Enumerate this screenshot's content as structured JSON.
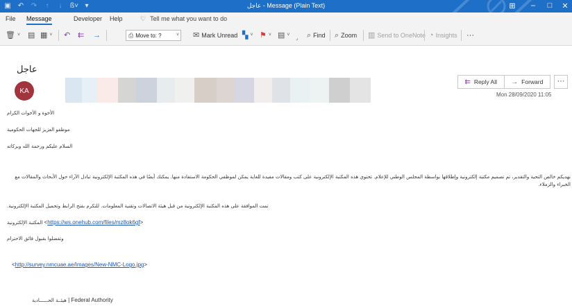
{
  "window": {
    "title": "عاجل  -  Message (Plain Text)",
    "quick_access_icons": [
      "save-icon",
      "undo-icon",
      "redo-icon",
      "up-icon",
      "down-icon",
      "format-icon",
      "customize-icon"
    ]
  },
  "menu": {
    "tabs": [
      "File",
      "Message",
      "Developer",
      "Help"
    ],
    "active_tab": "Message",
    "tell_me": "Tell me what you want to do"
  },
  "ribbon": {
    "move_to_label": "Move to: ?",
    "mark_unread": "Mark Unread",
    "find": "Find",
    "zoom": "Zoom",
    "send_to_onenote": "Send to OneNote",
    "insights": "Insights",
    "more": "···"
  },
  "message": {
    "subject": "عاجل",
    "avatar_initials": "KA",
    "reply_all": "Reply All",
    "forward": "Forward",
    "more": "···",
    "datetime": "Mon 28/09/2020 11:05",
    "recipient_colors": [
      "#ffffff",
      "#dbe6f3",
      "#e6f0f6",
      "#fbebe8",
      "#d5d5d3",
      "#ccd3dc",
      "#e9ecef",
      "#f0f0ee",
      "#d7cec7",
      "#dcd5d2",
      "#d6d7e3",
      "#f2eeed",
      "#dfe3e8",
      "#e8f2f2",
      "#edf3f3",
      "#cfcfcf",
      "#e4e4e4"
    ]
  },
  "body": {
    "greeting": "الأخوة و الأخوات الكرام",
    "line2": "موظفو العزيز للجهات الحكومية",
    "line3": "السلام عليكم ورحمة الله وبركاته",
    "paragraph": "نهديكم خالص التحية والتقدير، تم تصميم مكتبة إلكترونية وإطلاقها بواسطة المجلس الوطني للإعلام. تحتوي هذه المكتبة الإلكترونية على كتب ومقالات مفيدة للغاية يمكن لموظفي الحكومة الاستفادة منها. يمكنك أيضًا في هذه المكتبة الإلكترونية تبادل الآراء حول الأبحاث والمقالات مع الخبراء والزملاء.",
    "approval": "تمت الموافقة على هذه المكتبة الإلكترونية من قبل هيئة الاتصالات وتقنية المعلومات. للتكرم بفتح الرابط وتحميل المكتبة الإلكترونية.",
    "library_label": "المكتبة الإلكترونية",
    "library_link": "https://ws.onehub.com/files/mz8ok6gf",
    "closing": "وتفضلوا بقبول فائق الاحترام",
    "logo_link": "http://survey.nmcuae.ae/Images/New-NMC-Logo.jpg",
    "signature_ar": "هيئــة الحــــــادية",
    "signature_en": "Federal Authority"
  }
}
